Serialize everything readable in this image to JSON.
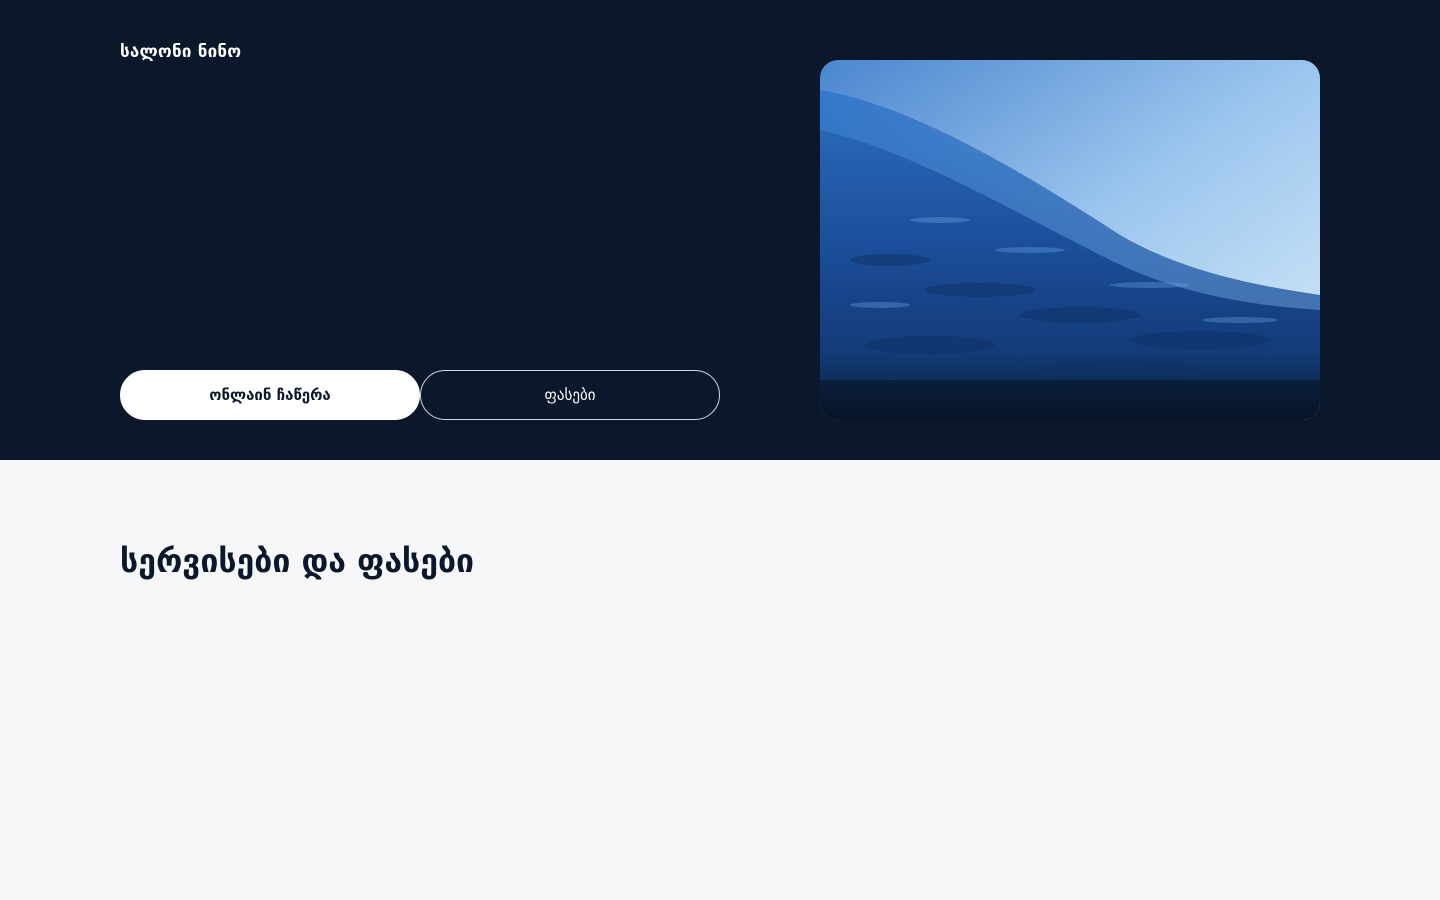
{
  "header": {
    "brand": "სალონი ნინო"
  },
  "hero": {
    "primary_button": "ონლაინ ჩაწერა",
    "secondary_button": "ფასები",
    "image": "ocean-wave-photo"
  },
  "services": {
    "title": "სერვისები და ფასები"
  },
  "colors": {
    "hero_background": "#0b172a",
    "page_background": "#f6f7f9",
    "button_primary": "#ffffff"
  }
}
